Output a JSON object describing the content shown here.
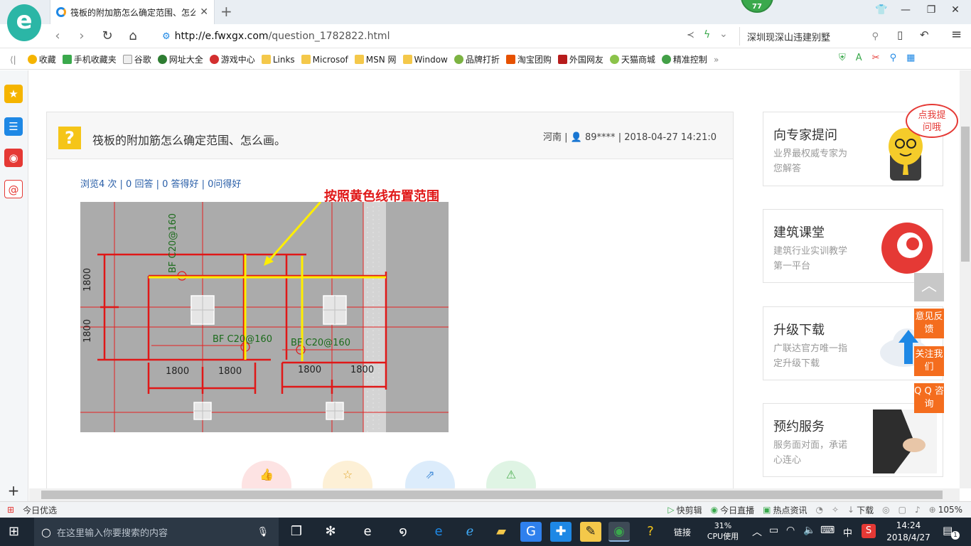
{
  "browser": {
    "tab_title": "筏板的附加筋怎么确定范围、怎么画。",
    "tab_close": "✕",
    "new_tab": "+",
    "badge": "77",
    "url_host": "http://e.fwxgx.com",
    "url_path": "/question_1782822.html",
    "search_text": "深圳现深山违建别墅"
  },
  "bookmarks": [
    {
      "label": "收藏",
      "color": "#f5b400"
    },
    {
      "label": "手机收藏夹",
      "color": "#3aa94c"
    },
    {
      "label": "谷歌",
      "color": "#9aa0a6"
    },
    {
      "label": "网址大全",
      "color": "#2e7d32"
    },
    {
      "label": "游戏中心",
      "color": "#d32f2f"
    },
    {
      "label": "Links",
      "color": "#f4c84a"
    },
    {
      "label": "Microsof",
      "color": "#f4c84a"
    },
    {
      "label": "MSN 网",
      "color": "#f4c84a"
    },
    {
      "label": "Window",
      "color": "#f4c84a"
    },
    {
      "label": "品牌打折",
      "color": "#7cb342"
    },
    {
      "label": "淘宝团购",
      "color": "#e65100"
    },
    {
      "label": "外国网友",
      "color": "#b71c1c"
    },
    {
      "label": "天猫商城",
      "color": "#8bc34a"
    },
    {
      "label": "精准控制",
      "color": "#43a047"
    }
  ],
  "question": {
    "title": "筏板的附加筋怎么确定范围、怎么画。",
    "region": "河南",
    "user": "89****",
    "datetime": "2018-04-27 14:21:0",
    "stats": "浏览4 次 | 0 回答 | 0 答得好 | 0问得好"
  },
  "figure": {
    "annotation": "按照黄色线布置范围",
    "label_top": "BF C20@160",
    "label_mid": "BF C20@160",
    "label_right": "BF C20@160",
    "dim_1800": "1800"
  },
  "side_cards": [
    {
      "title": "向专家提问",
      "desc": "业界最权威专家为您解答",
      "bubble": "点我提问哦"
    },
    {
      "title": "建筑课堂",
      "desc": "建筑行业实训教学第一平台"
    },
    {
      "title": "升级下载",
      "desc": "广联达官方唯一指定升级下载"
    },
    {
      "title": "预约服务",
      "desc": "服务面对面，承诺心连心"
    }
  ],
  "float_buttons": [
    "意见反馈",
    "关注我们",
    "Q Q 咨询"
  ],
  "statusbar": {
    "left": "今日优选",
    "items": [
      "快剪辑",
      "今日直播",
      "热点资讯"
    ],
    "download": "下载",
    "zoom": "105%"
  },
  "taskbar": {
    "search_placeholder": "在这里输入你要搜索的内容",
    "links": "链接",
    "cpu_percent": "31%",
    "cpu_label": "CPU使用",
    "ime": "中",
    "time": "14:24",
    "date": "2018/4/27",
    "notif_count": "1"
  }
}
